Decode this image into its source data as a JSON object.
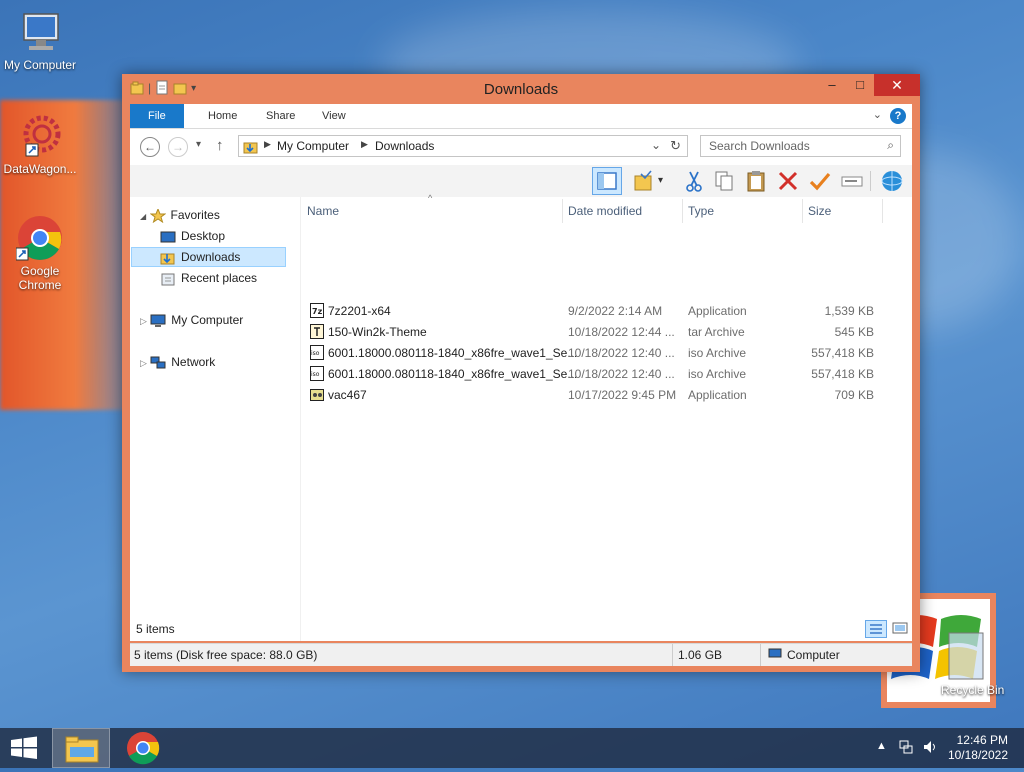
{
  "desktop": {
    "icons": [
      {
        "label": "My Computer"
      },
      {
        "label": "DataWagon..."
      },
      {
        "label": "Google Chrome"
      }
    ],
    "recycle_bin": {
      "label": "Recycle Bin"
    }
  },
  "window": {
    "title": "Downloads",
    "controls": {
      "minimize": "–",
      "maximize": "□",
      "close": "✕"
    },
    "ribbon_tabs": [
      "File",
      "Home",
      "Share",
      "View"
    ],
    "address": {
      "breadcrumbs": [
        "My Computer",
        "Downloads"
      ]
    },
    "search": {
      "placeholder": "Search Downloads"
    },
    "navigation": {
      "favorites": {
        "label": "Favorites",
        "items": [
          "Desktop",
          "Downloads",
          "Recent places"
        ]
      },
      "my_computer": "My Computer",
      "network": "Network",
      "selected": "Downloads"
    },
    "columns": {
      "name": "Name",
      "date": "Date modified",
      "type": "Type",
      "size": "Size"
    },
    "files": [
      {
        "name": "7z2201-x64",
        "date": "9/2/2022 2:14 AM",
        "type": "Application",
        "size": "1,539 KB",
        "icon": "7z-installer-icon"
      },
      {
        "name": "150-Win2k-Theme",
        "date": "10/18/2022 12:44 ...",
        "type": "tar Archive",
        "size": "545 KB",
        "icon": "archive-icon"
      },
      {
        "name": "6001.18000.080118-1840_x86fre_wave1_Se...",
        "date": "10/18/2022 12:40 ...",
        "type": "iso Archive",
        "size": "557,418 KB",
        "icon": "iso-icon"
      },
      {
        "name": "6001.18000.080118-1840_x86fre_wave1_Se...",
        "date": "10/18/2022 12:40 ...",
        "type": "iso Archive",
        "size": "557,418 KB",
        "icon": "iso-icon"
      },
      {
        "name": "vac467",
        "date": "10/17/2022 9:45 PM",
        "type": "Application",
        "size": "709 KB",
        "icon": "application-icon"
      }
    ],
    "item_count": "5 items",
    "status": {
      "summary": "5 items (Disk free space: 88.0 GB)",
      "size": "1.06 GB",
      "location": "Computer"
    }
  },
  "taskbar": {
    "time": "12:46 PM",
    "date": "10/18/2022"
  },
  "colors": {
    "window_frame": "#e9855e",
    "file_tab": "#1979ca",
    "close_button": "#c7302b",
    "selection": "#cce8ff"
  }
}
